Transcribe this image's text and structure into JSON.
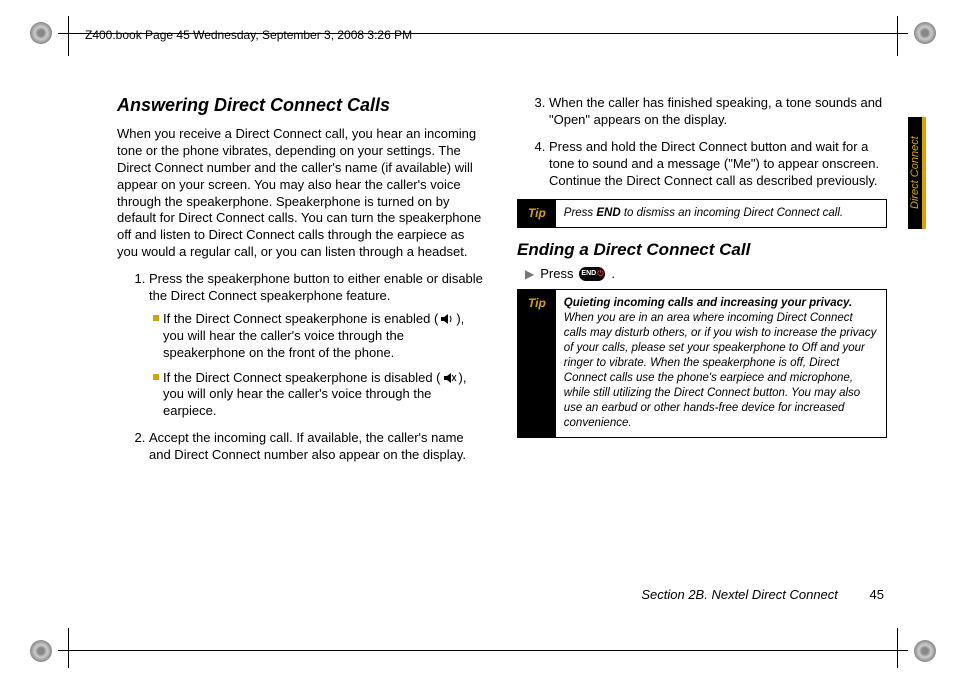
{
  "header": {
    "text": "Z400.book  Page 45  Wednesday, September 3, 2008  3:26 PM"
  },
  "sideTab": {
    "label": "Direct Connect"
  },
  "left": {
    "title": "Answering Direct Connect Calls",
    "intro": "When you receive a Direct Connect call, you hear an incoming tone or the phone vibrates, depending on your settings. The Direct Connect number and the caller's name (if available) will appear on your screen. You may also hear the caller's voice through the speakerphone. Speakerphone is turned on by default for Direct Connect calls. You can turn the speakerphone off and listen to Direct Connect calls through the earpiece as you would a regular call, or you can listen through a headset.",
    "step1": "Press the speakerphone button to either enable or disable the Direct Connect speakerphone feature.",
    "sub1a_pre": "If the Direct Connect speakerphone is enabled (",
    "sub1a_post": "), you will hear the caller's voice through the speakerphone on the front of the phone.",
    "sub1b_pre": "If the Direct Connect speakerphone is disabled (",
    "sub1b_post": "), you will only hear the caller's voice through the earpiece.",
    "step2": "Accept the incoming call. If available, the caller's name and Direct Connect number also appear on the display."
  },
  "right": {
    "step3": "When the caller has finished speaking, a tone sounds and \"Open\" appears on the display.",
    "step4": "Press and hold the Direct Connect button and wait for a tone to sound and a message (\"Me\") to appear onscreen. Continue the Direct Connect call as described previously.",
    "tip1": {
      "label": "Tip",
      "pre": "Press ",
      "bold": "END",
      "post": " to dismiss an incoming Direct Connect call."
    },
    "title2": "Ending a Direct Connect Call",
    "pressLabel": "Press",
    "endIcon": "END",
    "tip2": {
      "label": "Tip",
      "bold": "Quieting incoming calls and increasing your privacy.",
      "body": " When you are in an area where incoming Direct Connect calls may disturb others, or if you wish to increase the privacy of your calls, please set your speakerphone to Off and your ringer to vibrate. When the speakerphone is off, Direct Connect calls use the phone's earpiece and microphone, while still utilizing the Direct Connect button. You may also use an earbud or other hands-free device for increased convenience."
    }
  },
  "footer": {
    "section": "Section 2B. Nextel Direct Connect",
    "page": "45"
  }
}
